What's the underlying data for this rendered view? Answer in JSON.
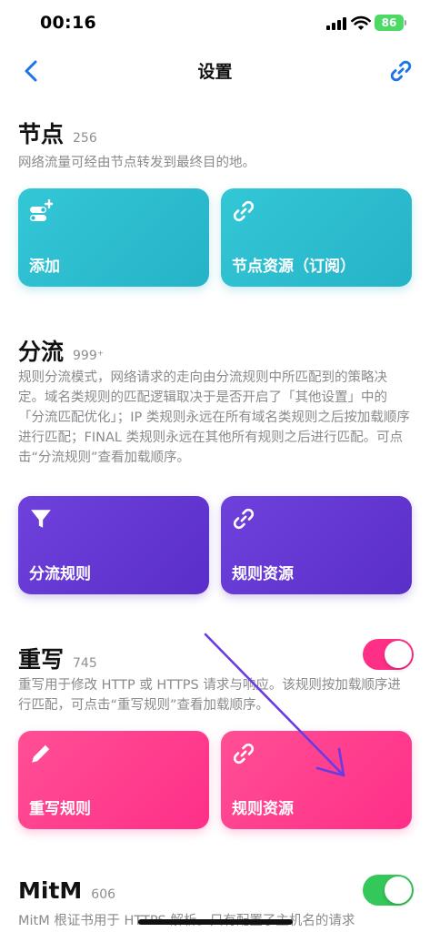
{
  "status_bar": {
    "time": "00:16",
    "battery": "86"
  },
  "nav": {
    "title": "设置"
  },
  "nodes": {
    "title": "节点",
    "count": "256",
    "description": "网络流量可经由节点转发到最终目的地。",
    "cards": [
      {
        "label": "添加"
      },
      {
        "label": "节点资源（订阅）"
      }
    ]
  },
  "routing": {
    "title": "分流",
    "count": "999⁺",
    "description": "规则分流模式，网络请求的走向由分流规则中所匹配到的策略决定。域名类规则的匹配逻辑取决于是否开启了「其他设置」中的「分流匹配优化」；IP 类规则永远在所有域名类规则之后按加载顺序进行匹配；FINAL 类规则永远在其他所有规则之后进行匹配。可点击“分流规则”查看加载顺序。",
    "cards": [
      {
        "label": "分流规则"
      },
      {
        "label": "规则资源"
      }
    ]
  },
  "rewrite": {
    "title": "重写",
    "count": "745",
    "enabled": true,
    "description": "重写用于修改 HTTP 或 HTTPS 请求与响应。该规则按加载顺序进行匹配，可点击“重写规则”查看加载顺序。",
    "cards": [
      {
        "label": "重写规则"
      },
      {
        "label": "规则资源"
      }
    ]
  },
  "mitm": {
    "title": "MitM",
    "count": "606",
    "enabled": true,
    "description": "MitM 根证书用于 HTTPS 解析。只有配置了主机名的请求"
  },
  "colors": {
    "accent_blue": "#1a73e8",
    "teal": "#2cbccf",
    "purple": "#6437d4",
    "pink": "#ff3a8c",
    "green": "#34c759"
  }
}
